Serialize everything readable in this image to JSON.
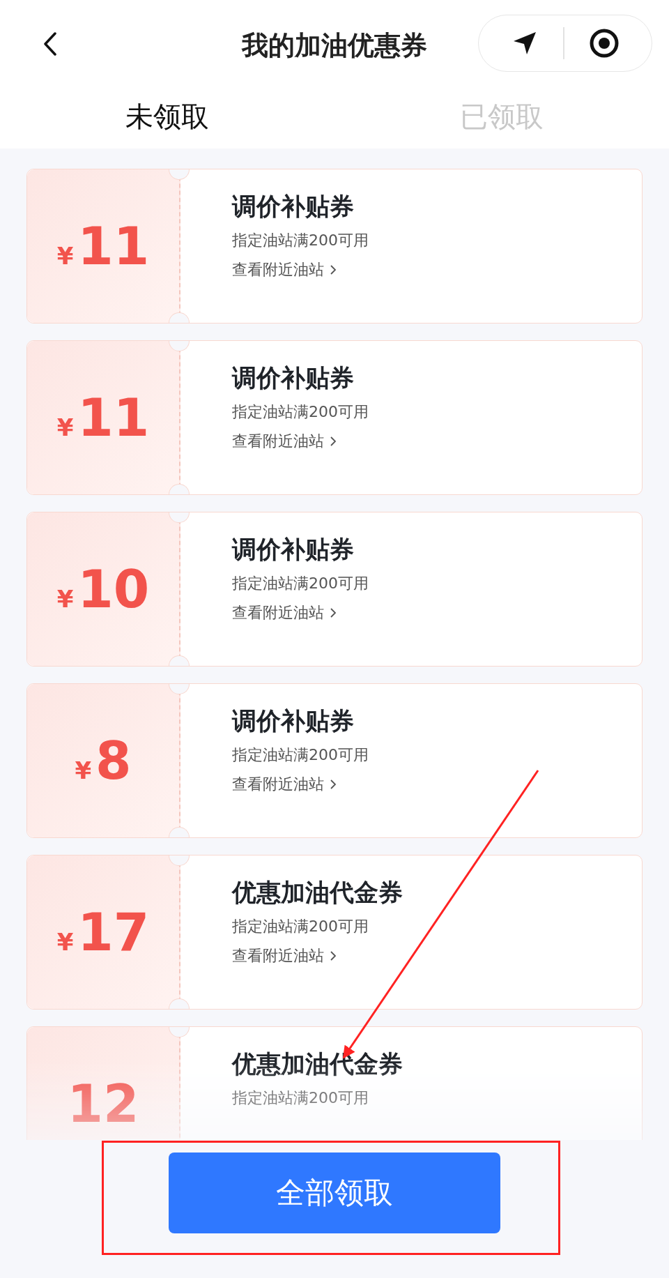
{
  "header": {
    "title": "我的加油优惠券"
  },
  "tabs": [
    {
      "label": "未领取",
      "selected": true
    },
    {
      "label": "已领取",
      "selected": false
    }
  ],
  "coupons": [
    {
      "currency": "¥",
      "amount": "11",
      "title": "调价补贴券",
      "condition": "指定油站满200可用",
      "link": "查看附近油站"
    },
    {
      "currency": "¥",
      "amount": "11",
      "title": "调价补贴券",
      "condition": "指定油站满200可用",
      "link": "查看附近油站"
    },
    {
      "currency": "¥",
      "amount": "10",
      "title": "调价补贴券",
      "condition": "指定油站满200可用",
      "link": "查看附近油站"
    },
    {
      "currency": "¥",
      "amount": "8",
      "title": "调价补贴券",
      "condition": "指定油站满200可用",
      "link": "查看附近油站"
    },
    {
      "currency": "¥",
      "amount": "17",
      "title": "优惠加油代金券",
      "condition": "指定油站满200可用",
      "link": "查看附近油站"
    },
    {
      "amount": "12",
      "title": "优惠加油代金券",
      "condition": "指定油站满200可用"
    }
  ],
  "claim_all_button": "全部领取"
}
